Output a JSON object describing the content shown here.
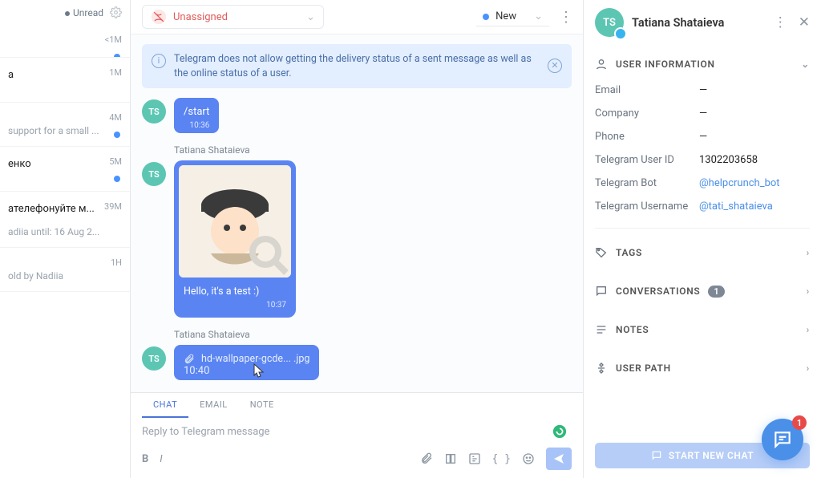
{
  "list": {
    "header_label": "Unread",
    "items": [
      {
        "title": "",
        "sub": "",
        "time": "<1M",
        "unread": true
      },
      {
        "title": "a",
        "sub": "",
        "time": "1M",
        "unread": false
      },
      {
        "title": "",
        "sub": "support for a small ...",
        "time": "4M",
        "unread": true
      },
      {
        "title": "енко",
        "sub": "",
        "time": "5M",
        "unread": true
      },
      {
        "title": "ателефонуйте м...",
        "sub": "adiia until: 16 Aug 2...",
        "time": "39M",
        "unread": false
      },
      {
        "title": "",
        "sub": "old by Nadiia",
        "time": "1H",
        "unread": false
      }
    ]
  },
  "chat": {
    "assign_label": "Unassigned",
    "status_label": "New",
    "banner": "Telegram does not allow getting the delivery status of a sent message as well as the online status of a user.",
    "msgs": {
      "m1": {
        "initials": "TS",
        "text": "/start",
        "time": "10:36"
      },
      "m2": {
        "initials": "TS",
        "sender": "Tatiana Shataieva",
        "caption": "Hello, it's a test :)",
        "time": "10:37"
      },
      "m3": {
        "initials": "TS",
        "sender": "Tatiana Shataieva",
        "filename": "hd-wallpaper-gcde... .jpg",
        "time": "10:40"
      }
    },
    "composer": {
      "tabs": {
        "chat": "CHAT",
        "email": "EMAIL",
        "note": "NOTE"
      },
      "placeholder": "Reply to Telegram message"
    }
  },
  "right": {
    "initials": "TS",
    "name": "Tatiana Shataieva",
    "user_info_h": "USER INFORMATION",
    "fields": {
      "email": {
        "k": "Email",
        "v": "—"
      },
      "company": {
        "k": "Company",
        "v": "—"
      },
      "phone": {
        "k": "Phone",
        "v": "—"
      },
      "tuid": {
        "k": "Telegram User ID",
        "v": "1302203658"
      },
      "tbot": {
        "k": "Telegram Bot",
        "v": "@helpcrunch_bot"
      },
      "tuser": {
        "k": "Telegram Username",
        "v": "@tati_shataieva"
      }
    },
    "sections": {
      "tags": "TAGS",
      "conv": "CONVERSATIONS",
      "conv_count": "1",
      "notes": "NOTES",
      "userpath": "USER PATH"
    },
    "start_chat": "START NEW CHAT",
    "fab_badge": "1"
  }
}
